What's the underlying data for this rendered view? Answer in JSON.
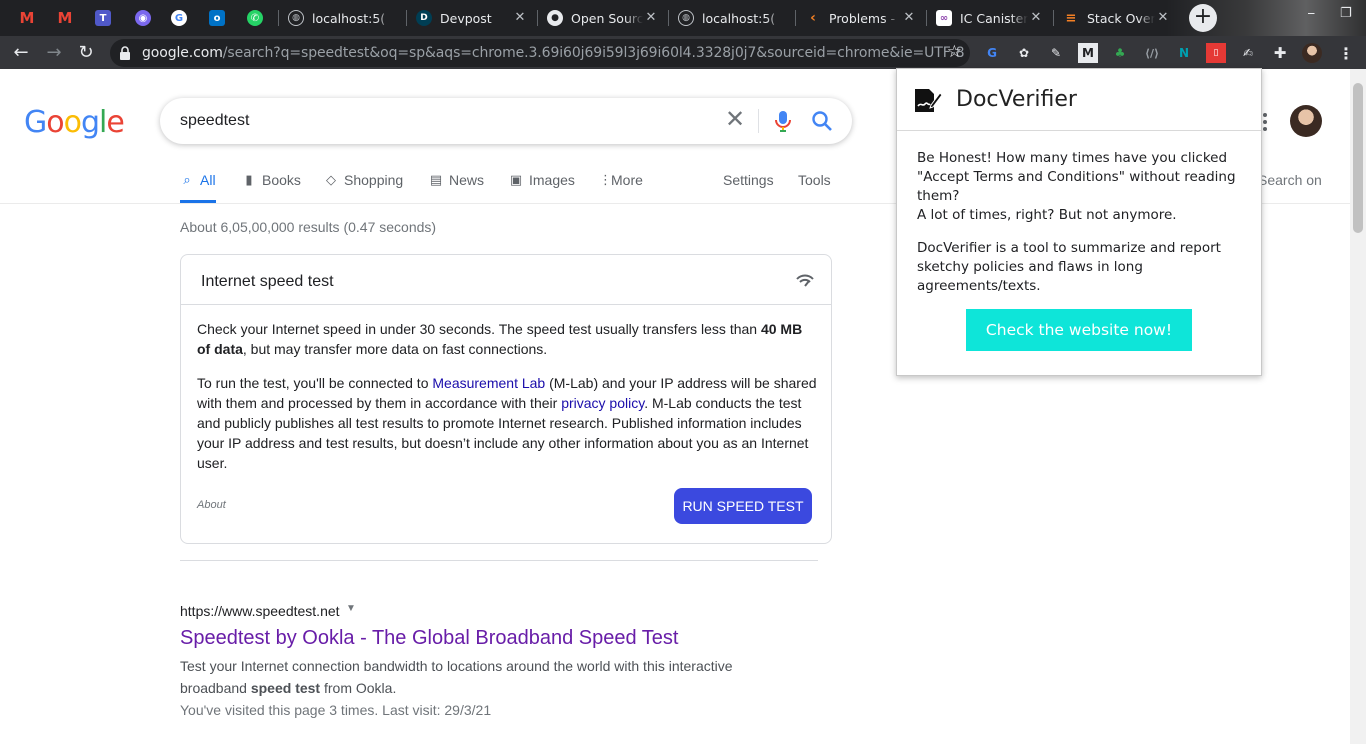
{
  "browser": {
    "tabs": [
      {
        "title": "localhost:5("
      },
      {
        "title": "Devpost"
      },
      {
        "title": "Open Sourc"
      },
      {
        "title": "localhost:5("
      },
      {
        "title": "Problems -"
      },
      {
        "title": "IC Canister"
      },
      {
        "title": "Stack Over"
      }
    ],
    "url_host": "google.com",
    "url_path": "/search?q=speedtest&oq=sp&aqs=chrome.3.69i60j69i59l3j69i60l4.3328j0j7&sourceid=chrome&ie=UTF-8",
    "extensions": [
      "google-icon",
      "cookie-icon",
      "pen-icon",
      "m-icon",
      "tree-icon",
      "code-icon",
      "n-icon",
      "pdf-icon",
      "docverifier-icon",
      "puzzle-icon"
    ]
  },
  "google": {
    "logo": [
      "G",
      "o",
      "o",
      "g",
      "l",
      "e"
    ],
    "logo_colors": [
      "#4285f4",
      "#ea4335",
      "#fbbc05",
      "#4285f4",
      "#34a853",
      "#ea4335"
    ],
    "query": "speedtest",
    "nav": [
      {
        "label": "All",
        "icon": "search-icon"
      },
      {
        "label": "Books",
        "icon": "book-icon"
      },
      {
        "label": "Shopping",
        "icon": "tag-icon"
      },
      {
        "label": "News",
        "icon": "news-icon"
      },
      {
        "label": "Images",
        "icon": "image-icon"
      },
      {
        "label": "More",
        "icon": "more-vert-icon"
      }
    ],
    "settings": "Settings",
    "tools": "Tools",
    "stats": "About 6,05,00,000 results (0.47 seconds)",
    "right_stub": "Search on",
    "speedtest": {
      "title": "Internet speed test",
      "p1_a": "Check your Internet speed in under 30 seconds. The speed test usually transfers less than ",
      "p1_b": "40 MB of data",
      "p1_c": ", but may transfer more data on fast connections.",
      "p2_a": "To run the test, you'll be connected to ",
      "p2_link1": "Measurement Lab",
      "p2_b": " (M-Lab) and your IP address will be shared with them and processed by them in accordance with their ",
      "p2_link2": "privacy policy",
      "p2_c": ". M-Lab conducts the test and publicly publishes all test results to promote Internet research. Published information includes your IP address and test results, but doesn’t include any other information about you as an Internet user.",
      "about": "About",
      "button": "RUN SPEED TEST"
    },
    "result": {
      "url": "https://www.speedtest.net",
      "title": "Speedtest by Ookla - The Global Broadband Speed Test",
      "snippet_a": "Test your Internet connection bandwidth to locations around the world with this interactive broadband ",
      "snippet_b": "speed test",
      "snippet_c": " from Ookla.",
      "visited": "You've visited this page 3 times. Last visit: 29/3/21"
    }
  },
  "popup": {
    "title": "DocVerifier",
    "p1": "Be Honest! How many times have you clicked \"Accept Terms and Conditions\" without reading them?",
    "p2": "A lot of times, right? But not anymore.",
    "p3": "DocVerifier is a tool to summarize and report sketchy policies and flaws in long agreements/texts.",
    "button": "Check the website now!",
    "accent": "#0ee5d9"
  }
}
